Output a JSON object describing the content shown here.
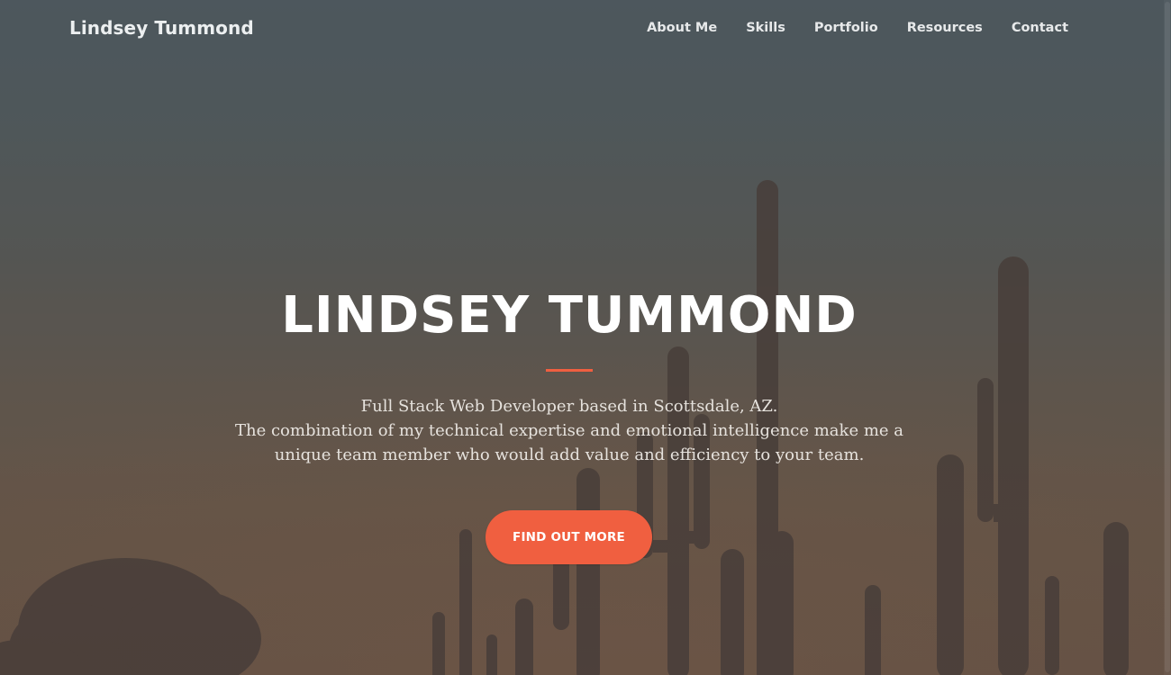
{
  "navbar": {
    "brand": "Lindsey Tummond",
    "links": [
      {
        "label": "About Me"
      },
      {
        "label": "Skills"
      },
      {
        "label": "Portfolio"
      },
      {
        "label": "Resources"
      },
      {
        "label": "Contact"
      }
    ]
  },
  "hero": {
    "title": "LINDSEY TUMMOND",
    "text_lines": [
      "Full Stack Web Developer based in Scottsdale, AZ.",
      "The combination of my technical expertise and emotional intelligence make me a",
      "unique team member who would add value and efficiency to your team."
    ],
    "cta_label": "FIND OUT MORE"
  },
  "colors": {
    "accent": "#f05f40",
    "text_light": "#ffffff",
    "background_top": "#505a60",
    "background_bottom": "#6a5243"
  }
}
